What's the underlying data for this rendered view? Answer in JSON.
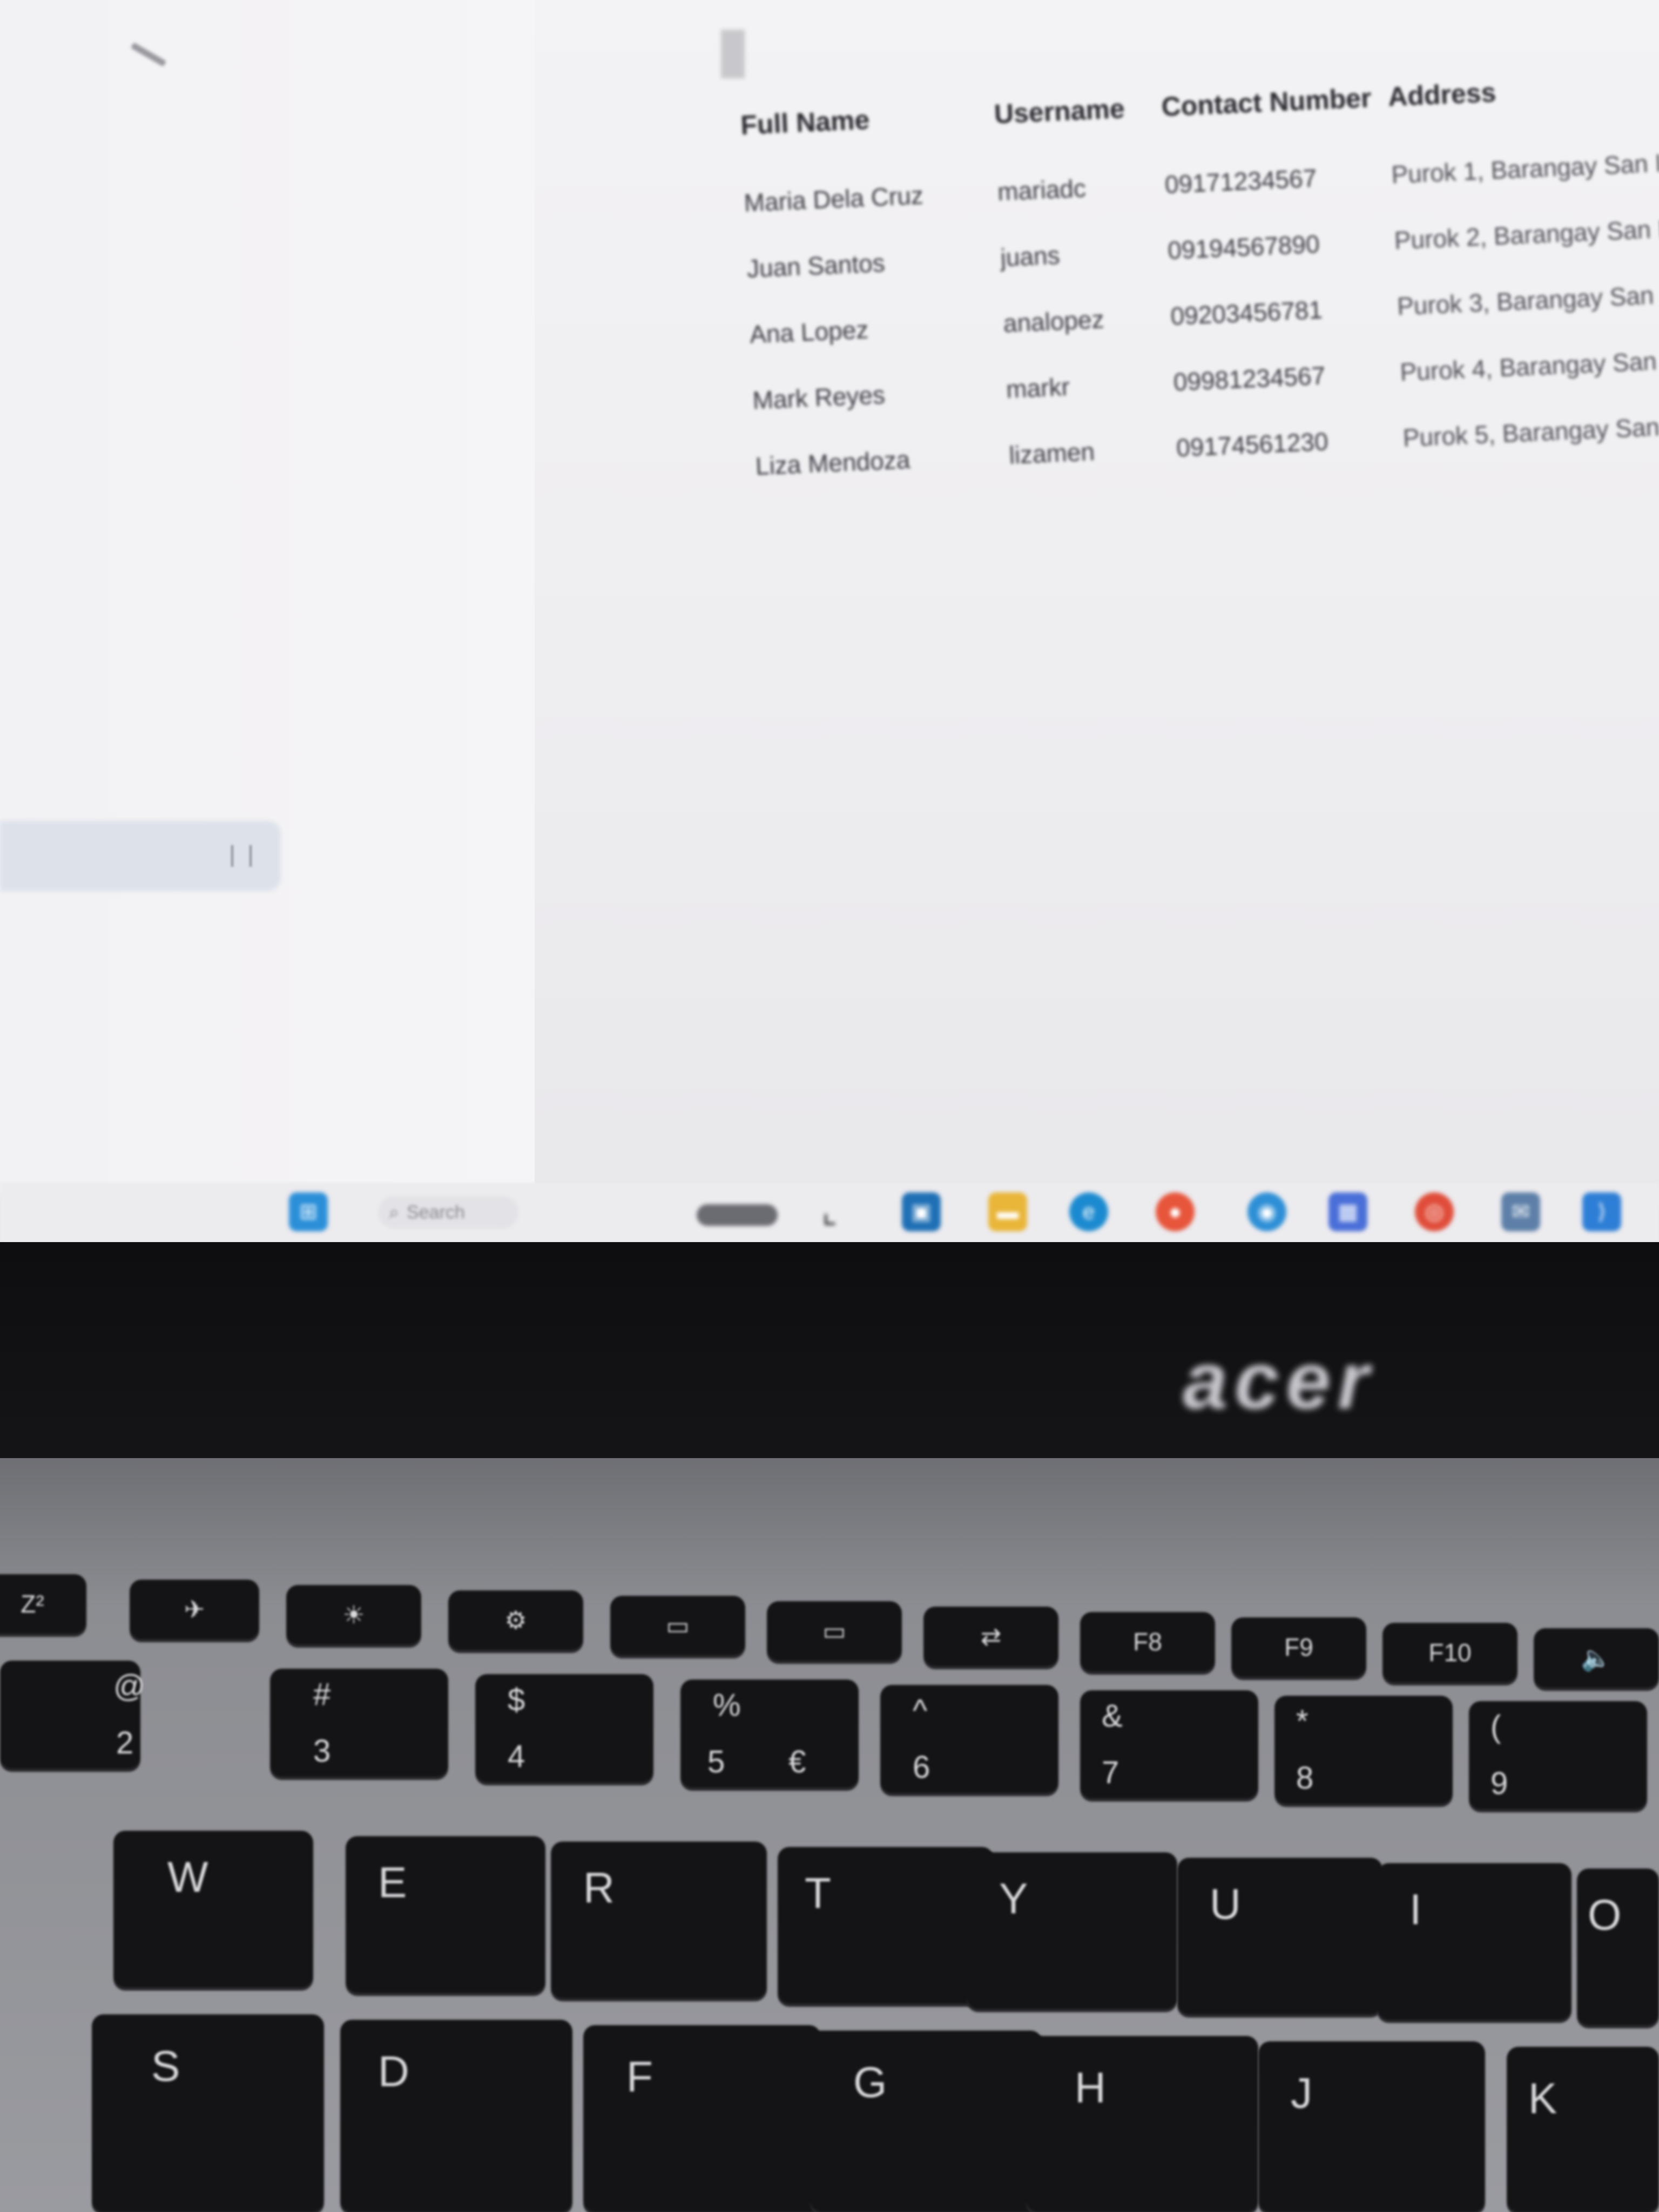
{
  "table": {
    "headers": [
      "Full Name",
      "Username",
      "Contact Number",
      "Address"
    ],
    "rows": [
      [
        "Maria Dela Cruz",
        "mariadc",
        "09171234567",
        "Purok 1, Barangay San Isidro"
      ],
      [
        "Juan Santos",
        "juans",
        "09194567890",
        "Purok 2, Barangay San Isidro"
      ],
      [
        "Ana Lopez",
        "analopez",
        "09203456781",
        "Purok 3, Barangay San Isidro"
      ],
      [
        "Mark Reyes",
        "markr",
        "09981234567",
        "Purok 4, Barangay San Isidro"
      ],
      [
        "Liza Mendoza",
        "lizamen",
        "09174561230",
        "Purok 5, Barangay San Isidro"
      ]
    ]
  },
  "taskbar": {
    "search_label": "Search",
    "icons": [
      "windows-icon",
      "search-icon",
      "widgets-icon",
      "task-view-icon",
      "file-explorer-icon",
      "folder-icon",
      "edge-icon",
      "firefox-icon",
      "app-icon",
      "store-icon",
      "chrome-icon",
      "mail-icon",
      "vscode-icon"
    ]
  },
  "brand": {
    "logo": "acer"
  },
  "keyboard": {
    "function_row": [
      "Z²",
      "✈",
      "☀",
      "⚙",
      "▭",
      "▭",
      "⇄",
      "F8",
      "F9",
      "F10",
      "🔈",
      "🔊"
    ],
    "number_row": [
      {
        "top": "@",
        "bottom": "2"
      },
      {
        "top": "#",
        "bottom": "3"
      },
      {
        "top": "$",
        "bottom": "4"
      },
      {
        "top": "%",
        "bottom": "5"
      },
      {
        "top": "^",
        "bottom": "6"
      },
      {
        "top": "&",
        "bottom": "7"
      },
      {
        "top": "*",
        "bottom": "8"
      },
      {
        "top": "(",
        "bottom": "9"
      }
    ],
    "euro": "€",
    "qwerty_row": [
      "W",
      "E",
      "R",
      "T",
      "Y",
      "U",
      "I",
      "O"
    ],
    "home_row": [
      "S",
      "D",
      "F",
      "G",
      "H",
      "J",
      "K"
    ]
  }
}
